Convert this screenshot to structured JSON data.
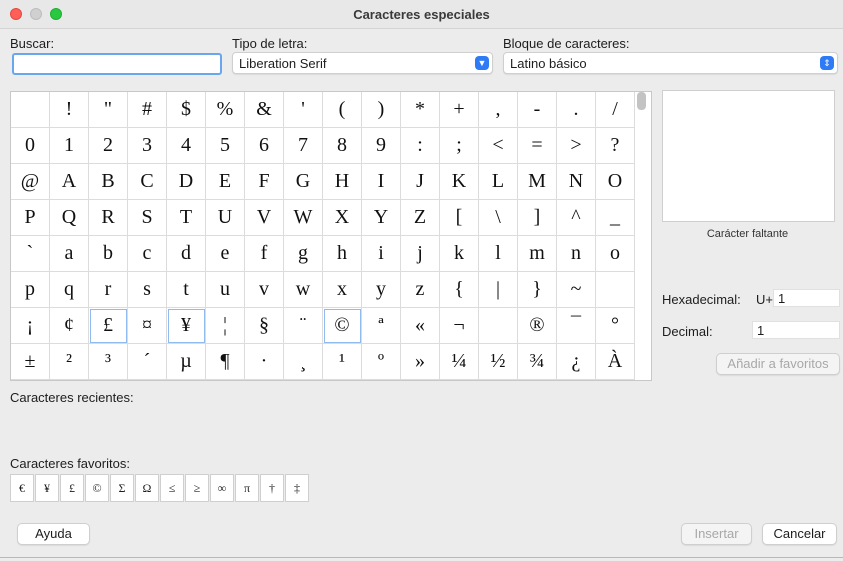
{
  "window": {
    "title": "Caracteres especiales"
  },
  "search": {
    "label": "Buscar:",
    "value": ""
  },
  "font": {
    "label": "Tipo de letra:",
    "value": "Liberation Serif"
  },
  "block": {
    "label": "Bloque de caracteres:",
    "value": "Latino básico"
  },
  "grid": {
    "rows": [
      [
        " ",
        "!",
        "\"",
        "#",
        "$",
        "%",
        "&",
        "'",
        "(",
        ")",
        "*",
        "+",
        ",",
        "-",
        ".",
        "/"
      ],
      [
        "0",
        "1",
        "2",
        "3",
        "4",
        "5",
        "6",
        "7",
        "8",
        "9",
        ":",
        ";",
        "<",
        "=",
        ">",
        "?"
      ],
      [
        "@",
        "A",
        "B",
        "C",
        "D",
        "E",
        "F",
        "G",
        "H",
        "I",
        "J",
        "K",
        "L",
        "M",
        "N",
        "O"
      ],
      [
        "P",
        "Q",
        "R",
        "S",
        "T",
        "U",
        "V",
        "W",
        "X",
        "Y",
        "Z",
        "[",
        "\\",
        "]",
        "^",
        "_"
      ],
      [
        "`",
        "a",
        "b",
        "c",
        "d",
        "e",
        "f",
        "g",
        "h",
        "i",
        "j",
        "k",
        "l",
        "m",
        "n",
        "o"
      ],
      [
        "p",
        "q",
        "r",
        "s",
        "t",
        "u",
        "v",
        "w",
        "x",
        "y",
        "z",
        "{",
        "|",
        "}",
        "~",
        ""
      ],
      [
        "¡",
        "¢",
        "£",
        "¤",
        "¥",
        "¦",
        "§",
        "¨",
        "©",
        "ª",
        "«",
        "¬",
        "",
        "®",
        "¯",
        "°"
      ],
      [
        "±",
        "²",
        "³",
        "´",
        "µ",
        "¶",
        "·",
        "¸",
        "¹",
        "º",
        "»",
        "¼",
        "½",
        "¾",
        "¿",
        "À"
      ]
    ]
  },
  "preview": {
    "missing_label": "Carácter faltante"
  },
  "hex": {
    "label": "Hexadecimal:",
    "prefix": "U+",
    "value": "1"
  },
  "decimal": {
    "label": "Decimal:",
    "value": "1"
  },
  "add_favorite": "Añadir a favoritos",
  "recent": {
    "label": "Caracteres recientes:"
  },
  "favorites": {
    "label": "Caracteres favoritos:",
    "items": [
      "€",
      "¥",
      "£",
      "©",
      "Σ",
      "Ω",
      "≤",
      "≥",
      "∞",
      "π",
      "†",
      "‡"
    ]
  },
  "buttons": {
    "help": "Ayuda",
    "insert": "Insertar",
    "cancel": "Cancelar"
  }
}
